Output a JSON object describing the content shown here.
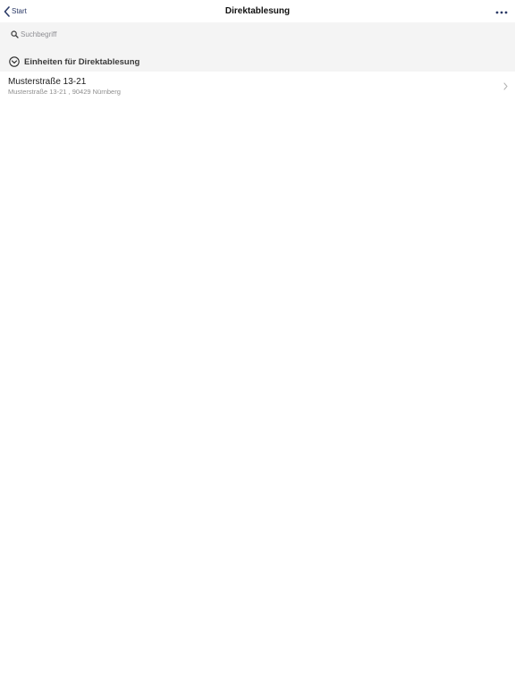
{
  "navbar": {
    "back_label": "Start",
    "title": "Direktablesung",
    "more_icon": "more-horizontal-icon"
  },
  "search": {
    "placeholder": "Suchbegriff",
    "value": ""
  },
  "section": {
    "title": "Einheiten für Direktablesung",
    "icon": "chevron-down-circle-icon"
  },
  "list": {
    "items": [
      {
        "title": "Musterstraße 13-21",
        "subtitle": "Musterstraße 13-21 , 90429 Nürnberg"
      }
    ]
  },
  "colors": {
    "accent": "#2b3a67",
    "section_bg": "#f4f4f4",
    "secondary_text": "#8f8f8f"
  }
}
